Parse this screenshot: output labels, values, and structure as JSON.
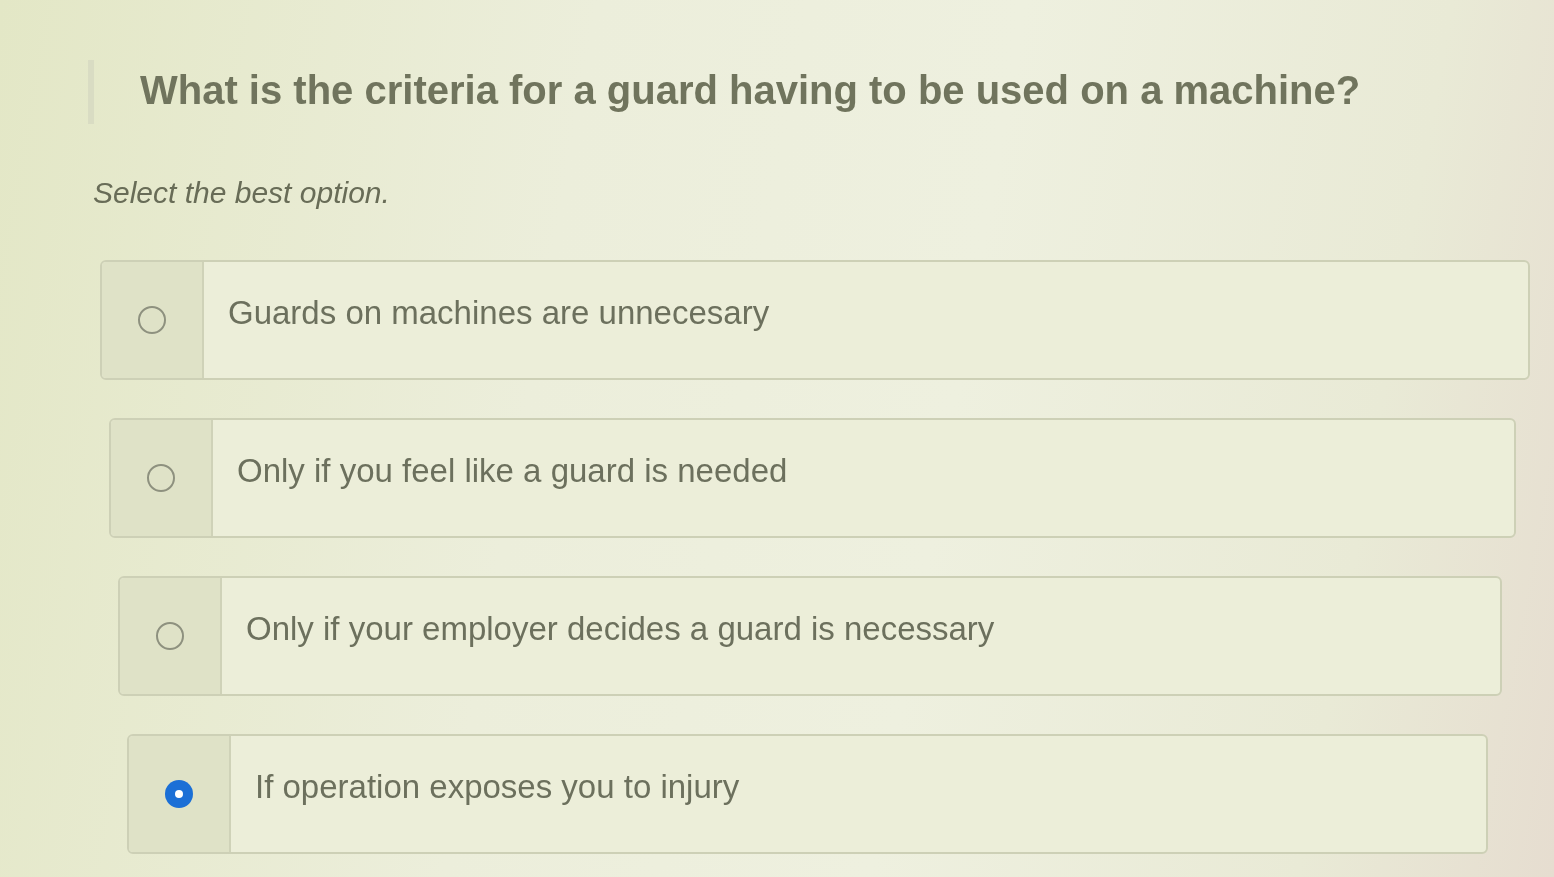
{
  "question": {
    "text": "What is the criteria for a guard having to be used on a machine?"
  },
  "instruction": "Select the best option.",
  "options": [
    {
      "label": "Guards on machines are unnecesary",
      "selected": false
    },
    {
      "label": "Only if you feel like a guard is needed",
      "selected": false
    },
    {
      "label": "Only if your employer decides a guard is necessary",
      "selected": false
    },
    {
      "label": "If operation exposes you to injury",
      "selected": true
    }
  ]
}
